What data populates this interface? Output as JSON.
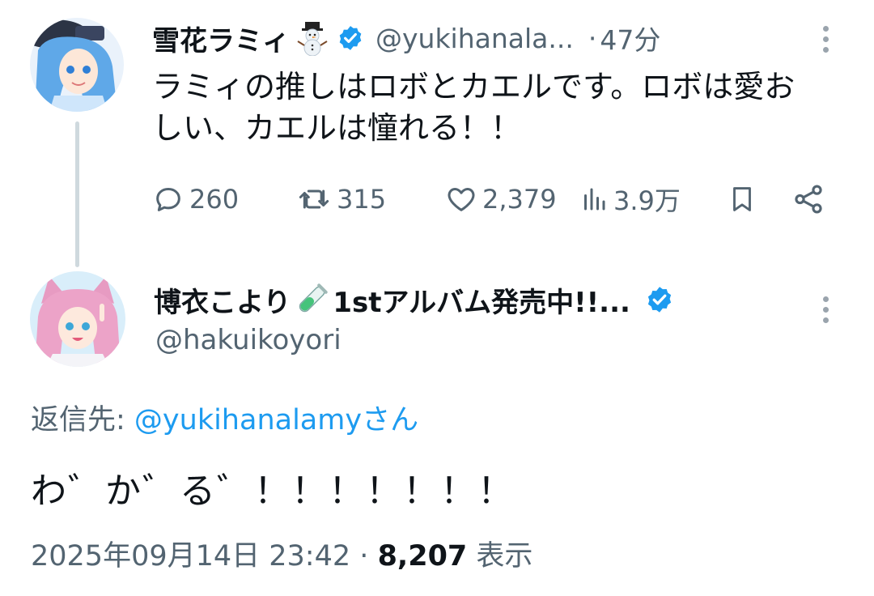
{
  "parent": {
    "name": "雪花ラミィ",
    "handle": "@yukihanala...",
    "dot": "·",
    "time": "47分",
    "text": "ラミィの推しはロボとカエルです。ロボは愛おしい、カエルは憧れる！！",
    "stats": {
      "replies": "260",
      "retweets": "315",
      "likes": "2,379",
      "views": "3.9万"
    }
  },
  "reply": {
    "name": "博衣こより",
    "name_suffix": "1stアルバム発売中!!...",
    "handle": "@hakuikoyori",
    "reply_to_label": "返信先: ",
    "reply_to_handle": "@yukihanalamy",
    "reply_to_suffix": "さん",
    "text": "わ゛か゛る゛！！！！！！！",
    "datetime": "2025年09月14日 23:42",
    "dot": "·",
    "views": "8,207",
    "views_label": "表示"
  },
  "icons": {
    "emoji_parent": "snowman-emoji",
    "emoji_reply": "test-tube-emoji",
    "verified": "verified-badge-icon",
    "more": "more-vertical-icon",
    "reply": "reply-bubble-icon",
    "retweet": "retweet-icon",
    "like": "heart-icon",
    "views": "bar-chart-icon",
    "bookmark": "bookmark-icon",
    "share": "share-icon"
  },
  "colors": {
    "text": "#0f1419",
    "secondary": "#536471",
    "link": "#1d9bf0",
    "verified": "#1d9bf0",
    "thread_line": "#cfd9de"
  }
}
